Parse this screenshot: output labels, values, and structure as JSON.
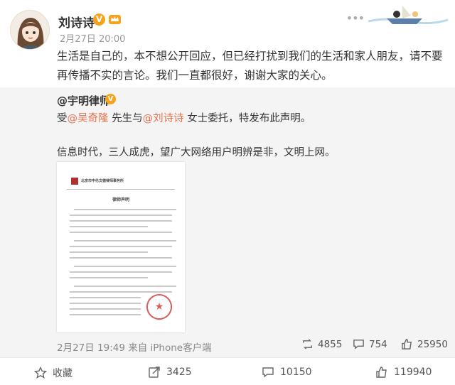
{
  "post": {
    "username": "刘诗诗",
    "verified_badge": "V",
    "timestamp": "2月27日 20:00",
    "text": "生活是自己的，本不想公开回应，但已经打扰到我们的生活和家人朋友，请不要再传播不实的言论。我们一直都很好，谢谢大家的关心。"
  },
  "repost": {
    "author": "@宇明律师",
    "verified_badge": "V",
    "line1_prefix": "受",
    "mention1": "@吴奇隆",
    "line1_mid": " 先生与",
    "mention2": "@刘诗诗",
    "line1_suffix": " 女士委托，特发布此声明。",
    "line2": "信息时代，三人成虎，望广大网络用户明辨是非，文明上网。",
    "document": {
      "firm_name": "北京市中伦文德律师事务所",
      "title": "律师声明"
    },
    "footer_time": "2月27日 19:49 来自 iPhone客户端",
    "stats": {
      "reposts": "4855",
      "comments": "754",
      "likes": "25950"
    }
  },
  "toolbar": {
    "favorite_label": "收藏",
    "reposts": "3425",
    "comments": "10150",
    "likes": "119940"
  },
  "colors": {
    "mention": "#eb7350",
    "badge": "#f7a319",
    "repost_bg": "#f4f4f4"
  },
  "icons": [
    "more-icon",
    "repost-icon",
    "comment-icon",
    "like-icon",
    "star-icon",
    "crown-icon"
  ]
}
